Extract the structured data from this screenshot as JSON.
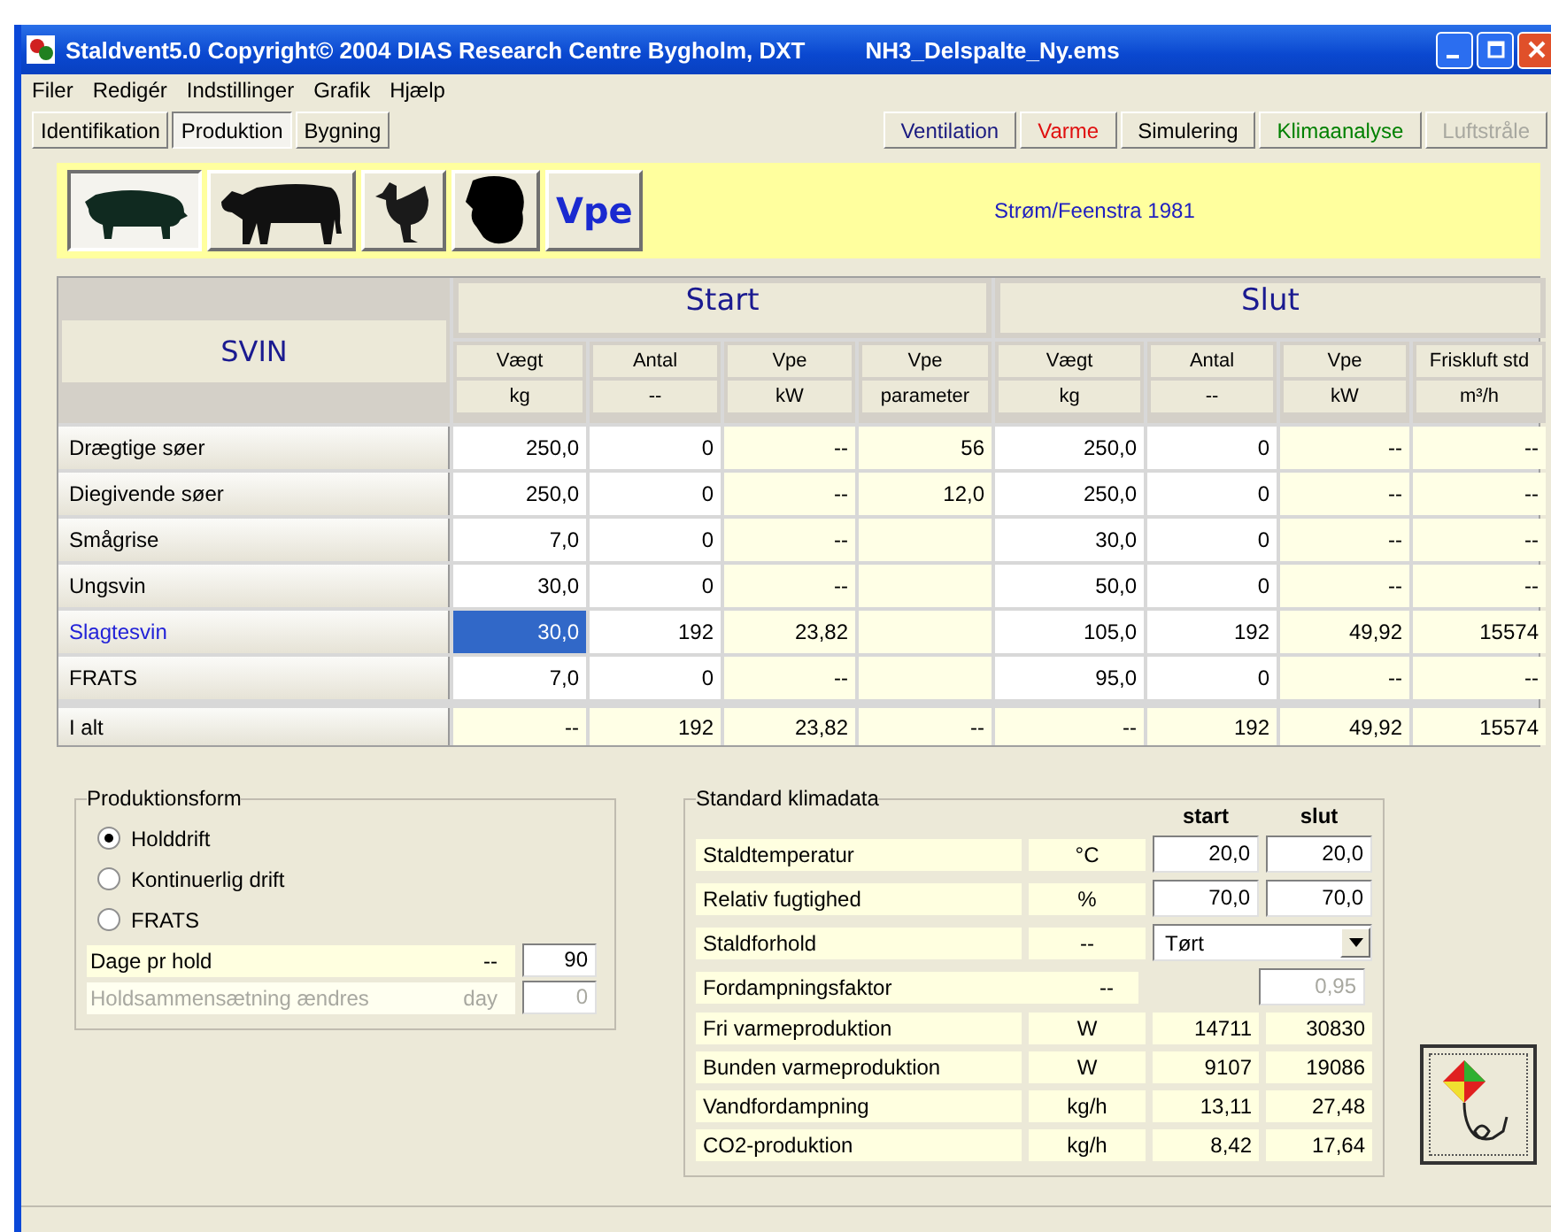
{
  "window": {
    "title": "Staldvent5.0  Copyright© 2004 DIAS Research Centre Bygholm, DXT",
    "file": "NH3_Delspalte_Ny.ems"
  },
  "menu": [
    "Filer",
    "Redigér",
    "Indstillinger",
    "Grafik",
    "Hjælp"
  ],
  "tabs": [
    {
      "label": "Identifikation",
      "selected": false
    },
    {
      "label": "Produktion",
      "selected": true
    },
    {
      "label": "Bygning",
      "selected": false
    }
  ],
  "actions": [
    {
      "label": "Ventilation",
      "color": "#1a1a80",
      "disabled": false
    },
    {
      "label": "Varme",
      "color": "#e01010",
      "disabled": false
    },
    {
      "label": "Simulering",
      "color": "#000000",
      "disabled": false
    },
    {
      "label": "Klimaanalyse",
      "color": "#008000",
      "disabled": false
    },
    {
      "label": "Luftstråle",
      "disabled": true
    }
  ],
  "animals": [
    {
      "kind": "pig",
      "selected": true
    },
    {
      "kind": "cow",
      "selected": false
    },
    {
      "kind": "hen",
      "selected": false
    },
    {
      "kind": "turkey",
      "selected": false
    },
    {
      "kind": "text",
      "label": "Vpe",
      "selected": false
    }
  ],
  "reference": "Strøm/Feenstra 1981",
  "table": {
    "corner": "SVIN",
    "groups": [
      "Start",
      "Slut"
    ],
    "columns": [
      {
        "name": "Vægt",
        "unit": "kg",
        "kind": "input"
      },
      {
        "name": "Antal",
        "unit": "--",
        "kind": "input"
      },
      {
        "name": "Vpe",
        "unit": "kW",
        "kind": "calc"
      },
      {
        "name": "Vpe",
        "unit": "parameter",
        "kind": "calc"
      },
      {
        "name": "Vægt",
        "unit": "kg",
        "kind": "input"
      },
      {
        "name": "Antal",
        "unit": "--",
        "kind": "input"
      },
      {
        "name": "Vpe",
        "unit": "kW",
        "kind": "calc"
      },
      {
        "name": "Friskluft std",
        "unit": "m³/h",
        "kind": "calc"
      }
    ],
    "rows": [
      {
        "label": "Drægtige søer",
        "selected": false,
        "kind": "data",
        "cells": [
          "250,0",
          "0",
          "--",
          "56",
          "250,0",
          "0",
          "--",
          "--"
        ]
      },
      {
        "label": "Diegivende søer",
        "selected": false,
        "kind": "data",
        "cells": [
          "250,0",
          "0",
          "--",
          "12,0",
          "250,0",
          "0",
          "--",
          "--"
        ]
      },
      {
        "label": "Smågrise",
        "selected": false,
        "kind": "data",
        "cells": [
          "7,0",
          "0",
          "--",
          null,
          "30,0",
          "0",
          "--",
          "--"
        ]
      },
      {
        "label": "Ungsvin",
        "selected": false,
        "kind": "data",
        "cells": [
          "30,0",
          "0",
          "--",
          null,
          "50,0",
          "0",
          "--",
          "--"
        ]
      },
      {
        "label": "Slagtesvin",
        "selected": true,
        "kind": "data",
        "cells": [
          "30,0",
          "192",
          "23,82",
          null,
          "105,0",
          "192",
          "49,92",
          "15574"
        ]
      },
      {
        "label": "FRATS",
        "selected": false,
        "kind": "data",
        "cells": [
          "7,0",
          "0",
          "--",
          null,
          "95,0",
          "0",
          "--",
          "--"
        ]
      },
      {
        "label": "I alt",
        "selected": false,
        "kind": "total",
        "cells": [
          "--",
          "192",
          "23,82",
          "--",
          "--",
          "192",
          "49,92",
          "15574"
        ]
      }
    ]
  },
  "production": {
    "title": "Produktionsform",
    "options": [
      {
        "label": "Holddrift",
        "selected": true
      },
      {
        "label": "Kontinuerlig drift",
        "selected": false
      },
      {
        "label": "FRATS",
        "selected": false
      }
    ],
    "fields": [
      {
        "label": "Dage pr hold",
        "unit": "--",
        "value": "90",
        "disabled": false
      },
      {
        "label": "Holdsammensætning ændres",
        "unit": "day",
        "value": "0",
        "disabled": true
      }
    ]
  },
  "climate": {
    "title": "Standard klimadata",
    "heads": [
      "start",
      "slut"
    ],
    "rows": [
      {
        "kind": "input",
        "label": "Staldtemperatur",
        "unit": "°C",
        "values": [
          "20,0",
          "20,0"
        ]
      },
      {
        "kind": "input",
        "label": "Relativ fugtighed",
        "unit": "%",
        "values": [
          "70,0",
          "70,0"
        ]
      },
      {
        "kind": "select",
        "label": "Staldforhold",
        "unit": "--",
        "value": "Tørt"
      },
      {
        "kind": "factor",
        "label": "Fordampningsfaktor",
        "unit": "--",
        "value": "0,95",
        "disabled": true
      },
      {
        "kind": "output",
        "label": "Fri varmeproduktion",
        "unit": "W",
        "values": [
          "14711",
          "30830"
        ]
      },
      {
        "kind": "output",
        "label": "Bunden varmeproduktion",
        "unit": "W",
        "values": [
          "9107",
          "19086"
        ]
      },
      {
        "kind": "output",
        "label": "Vandfordampning",
        "unit": "kg/h",
        "values": [
          "13,11",
          "27,48"
        ]
      },
      {
        "kind": "output",
        "label": "CO2-produktion",
        "unit": "kg/h",
        "values": [
          "8,42",
          "17,64"
        ]
      }
    ]
  }
}
